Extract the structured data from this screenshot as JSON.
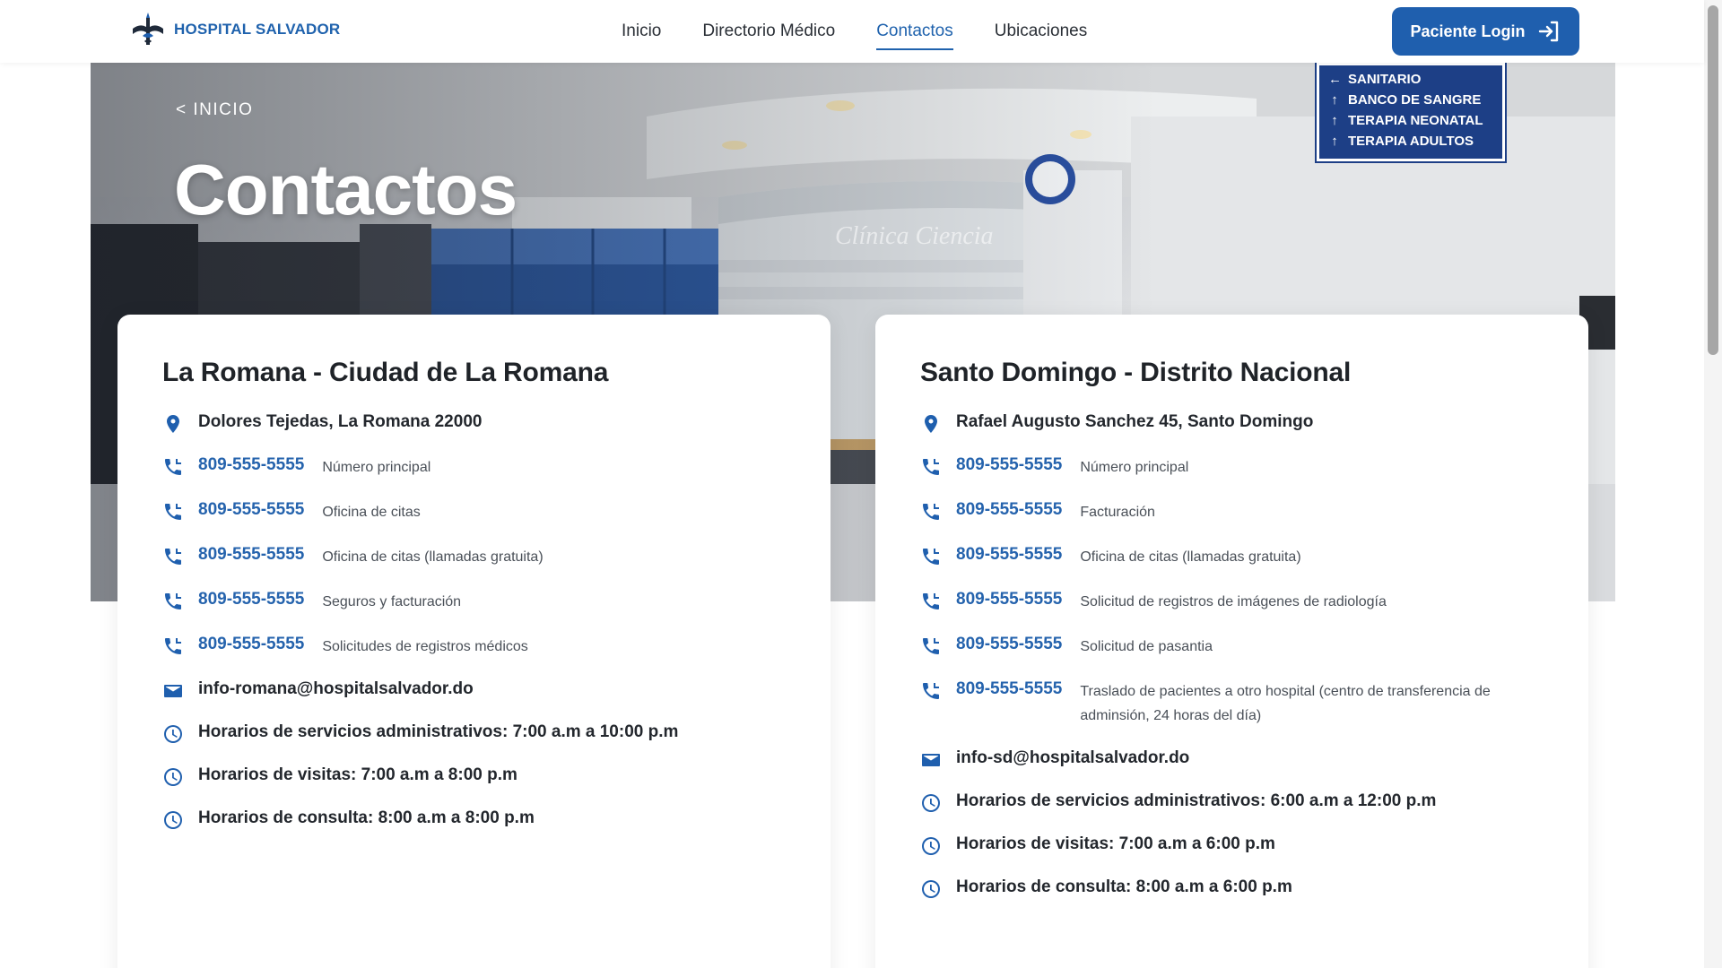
{
  "header": {
    "brand": "HOSPITAL SALVADOR",
    "nav": [
      {
        "label": "Inicio",
        "active": false
      },
      {
        "label": "Directorio Médico",
        "active": false
      },
      {
        "label": "Contactos",
        "active": true
      },
      {
        "label": "Ubicaciones",
        "active": false
      }
    ],
    "login_label": "Paciente Login",
    "login_icon": "login-arrow-icon"
  },
  "hero": {
    "breadcrumb": "< INICIO",
    "title": "Contactos",
    "sign_lines": [
      "SANITARIO",
      "BANCO DE SANGRE",
      "TERAPIA NEONATAL",
      "TERAPIA ADULTOS"
    ],
    "wall_text": "Clínica Ciencia"
  },
  "locations": [
    {
      "title": "La Romana - Ciudad de La Romana",
      "address": "Dolores Tejedas, La Romana 22000",
      "phones": [
        {
          "number": "809-555-5555",
          "desc": "Número principal"
        },
        {
          "number": "809-555-5555",
          "desc": "Oficina de citas"
        },
        {
          "number": "809-555-5555",
          "desc": "Oficina de citas (llamadas gratuita)"
        },
        {
          "number": "809-555-5555",
          "desc": "Seguros y facturación"
        },
        {
          "number": "809-555-5555",
          "desc": "Solicitudes de registros médicos"
        }
      ],
      "email": "info-romana@hospitalsalvador.do",
      "hours": [
        "Horarios de servicios administrativos: 7:00 a.m a 10:00 p.m",
        "Horarios de visitas: 7:00 a.m a 8:00 p.m",
        "Horarios de consulta: 8:00 a.m a 8:00 p.m"
      ]
    },
    {
      "title": "Santo Domingo - Distrito Nacional",
      "address": "Rafael Augusto Sanchez 45, Santo Domingo",
      "phones": [
        {
          "number": "809-555-5555",
          "desc": "Número principal"
        },
        {
          "number": "809-555-5555",
          "desc": "Facturación"
        },
        {
          "number": "809-555-5555",
          "desc": "Oficina de citas (llamadas gratuita)"
        },
        {
          "number": "809-555-5555",
          "desc": "Solicitud de registros de imágenes de radiología"
        },
        {
          "number": "809-555-5555",
          "desc": "Solicitud de pasantia"
        },
        {
          "number": "809-555-5555",
          "desc": "Traslado de pacientes a otro hospital (centro de transferencia de adminsión, 24 horas del día)"
        }
      ],
      "email": "info-sd@hospitalsalvador.do",
      "hours": [
        "Horarios de servicios administrativos: 6:00 a.m a 12:00 p.m",
        "Horarios de visitas: 7:00 a.m a 6:00 p.m",
        "Horarios de consulta: 8:00 a.m a 6:00 p.m"
      ]
    }
  ],
  "colors": {
    "brand_blue": "#1f5fae",
    "link_blue": "#2563ad",
    "sign_blue": "#1d3f86"
  }
}
